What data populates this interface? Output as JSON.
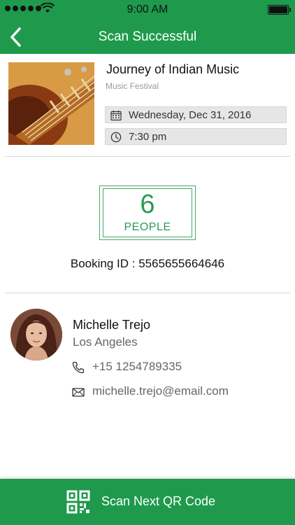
{
  "status_bar": {
    "time": "9:00 AM"
  },
  "nav": {
    "title": "Scan Successful"
  },
  "event": {
    "title": "Journey of Indian Music",
    "category": "Music Festival",
    "date": "Wednesday, Dec 31, 2016",
    "time": "7:30 pm"
  },
  "people": {
    "count": "6",
    "label": "PEOPLE"
  },
  "booking": {
    "text": "Booking ID : 5565655664646"
  },
  "contact": {
    "name": "Michelle Trejo",
    "city": "Los Angeles",
    "phone": "+15 1254789335",
    "email": "michelle.trejo@email.com"
  },
  "footer": {
    "button_label": "Scan Next QR Code"
  },
  "colors": {
    "brand_green": "#1f9a4c",
    "accent_green": "#2a9a55"
  },
  "icons": {
    "back": "chevron-left-icon",
    "calendar": "calendar-icon",
    "clock": "clock-icon",
    "phone": "phone-icon",
    "email": "envelope-icon",
    "qr": "qr-code-icon"
  }
}
